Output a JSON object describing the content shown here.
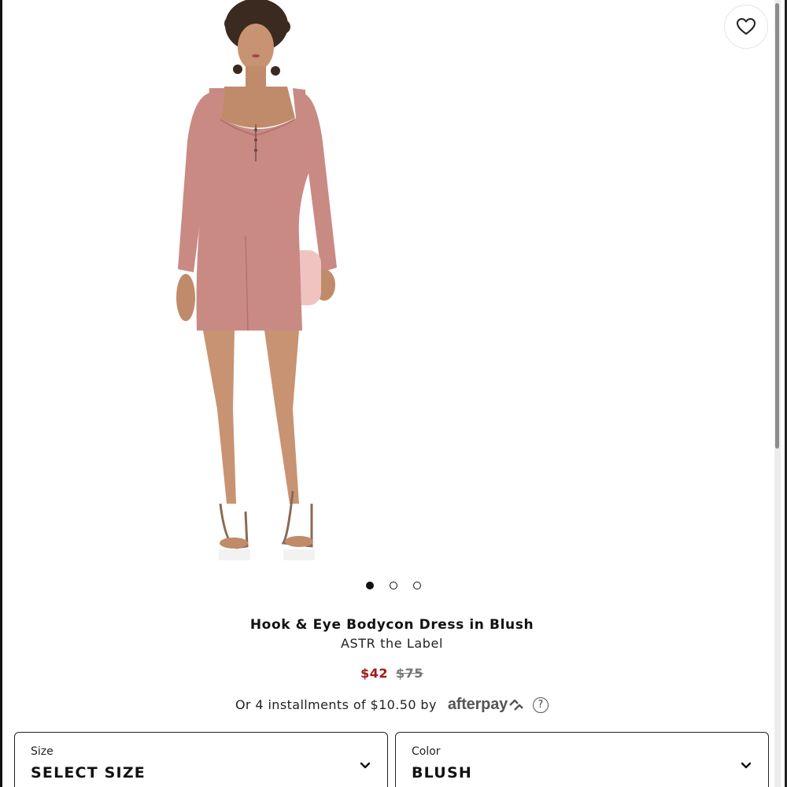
{
  "product": {
    "title": "Hook & Eye Bodycon Dress in Blush",
    "brand": "ASTR the Label",
    "sale_price": "$42",
    "original_price": "$75"
  },
  "carousel": {
    "slide_count": 3,
    "active_index": 0
  },
  "afterpay": {
    "text": "Or 4 installments of $10.50 by",
    "logo_text": "afterpay",
    "help_glyph": "?"
  },
  "selectors": {
    "size": {
      "label": "Size",
      "value": "SELECT SIZE"
    },
    "color": {
      "label": "Color",
      "value": "BLUSH"
    }
  },
  "icons": {
    "favorite": "heart-outline-icon",
    "dropdown": "chevron-down-icon",
    "help": "question-circle-icon"
  },
  "colors": {
    "sale_price": "#a4161a",
    "original_price": "#777777",
    "dress": "#c98a84"
  }
}
